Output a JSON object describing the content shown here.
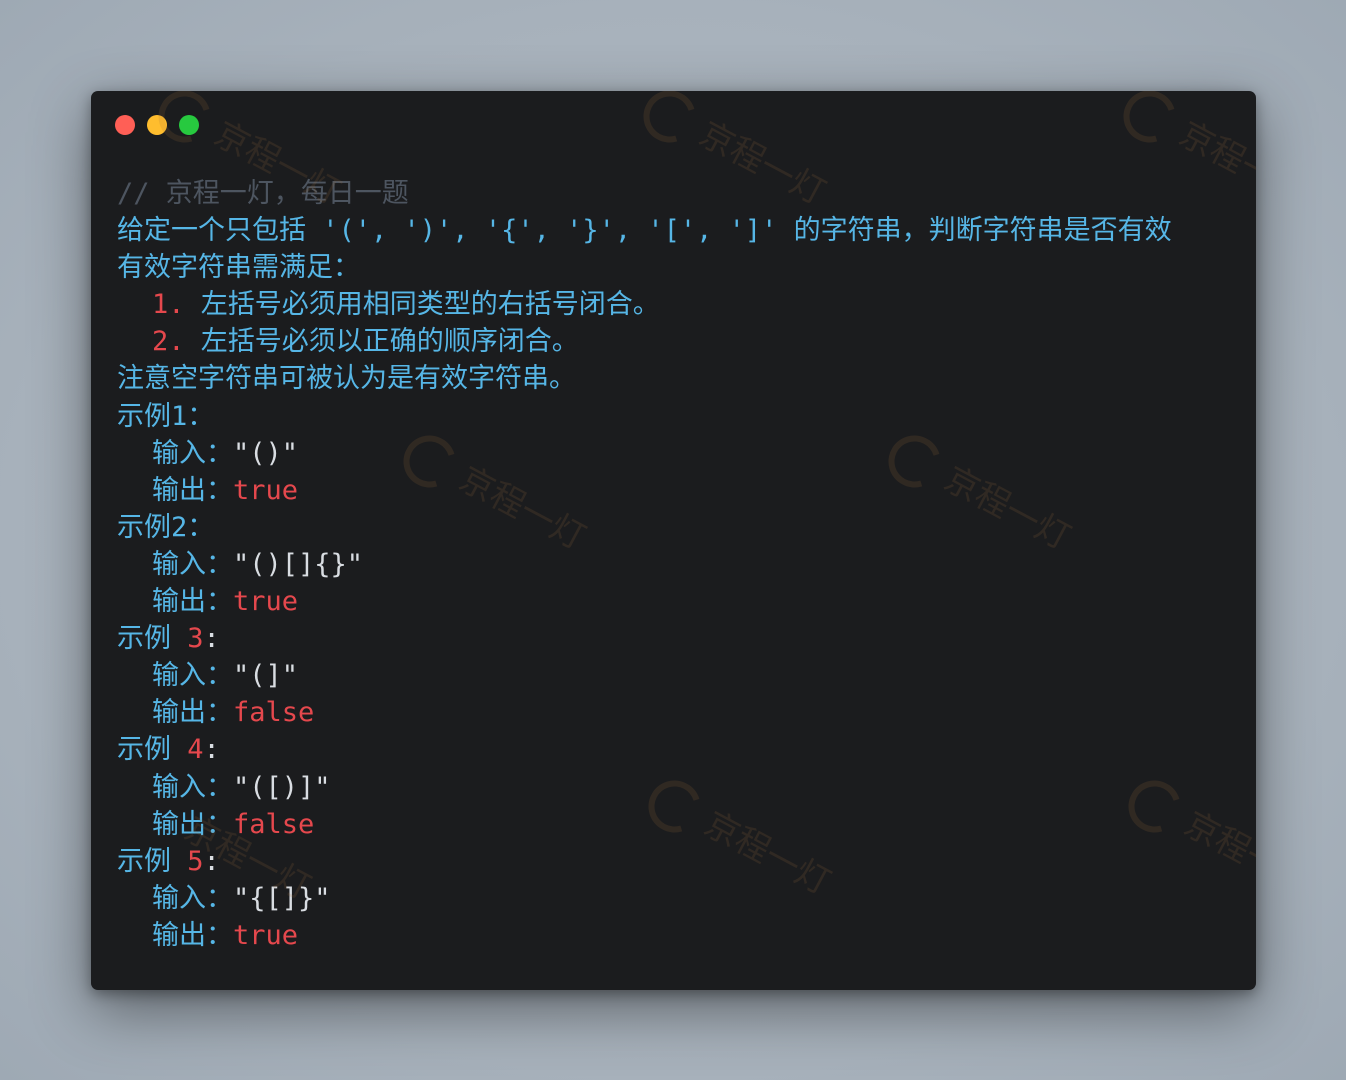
{
  "window": {
    "controls": [
      "close",
      "minimize",
      "maximize"
    ],
    "colors": {
      "close": "#ff5f56",
      "minimize": "#ffbd2e",
      "maximize": "#27c93f"
    }
  },
  "code": {
    "comment": "// 京程一灯，每日一题",
    "line1_text": "给定一个只包括 ",
    "line1_tokens": "'(', ')', '{', '}', '[', ']'",
    "line1_tail": " 的字符串，判断字符串是否有效",
    "line2": "有效字符串需满足：",
    "rule1_num": "1.",
    "rule1_text": " 左括号必须用相同类型的右括号闭合。",
    "rule2_num": "2.",
    "rule2_text": " 左括号必须以正确的顺序闭合。",
    "note": "注意空字符串可被认为是有效字符串。",
    "examples": [
      {
        "label": "示例1：",
        "input_label": "输入：",
        "input": "\"()\"",
        "output_label": "输出：",
        "output": "true"
      },
      {
        "label": "示例2：",
        "input_label": "输入：",
        "input": "\"()[]{}\"",
        "output_label": "输出：",
        "output": "true"
      },
      {
        "label_text": "示例 ",
        "label_num": "3",
        "label_colon": ":",
        "input_label": "输入：",
        "input": "\"(]\"",
        "output_label": "输出：",
        "output": "false"
      },
      {
        "label_text": "示例 ",
        "label_num": "4",
        "label_colon": ":",
        "input_label": "输入：",
        "input": "\"([)]\"",
        "output_label": "输出：",
        "output": "false"
      },
      {
        "label_text": "示例 ",
        "label_num": "5",
        "label_colon": ":",
        "input_label": "输入：",
        "input": "\"{[]}\"",
        "output_label": "输出：",
        "output": "true"
      }
    ]
  },
  "watermark": {
    "text": "京程一灯"
  }
}
